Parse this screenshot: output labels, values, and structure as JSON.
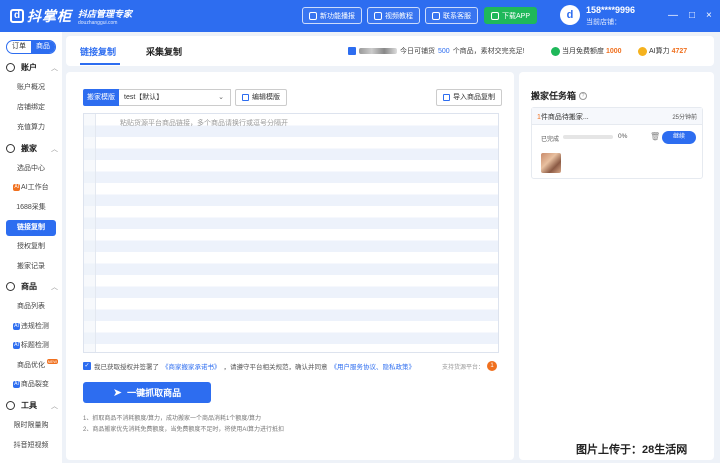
{
  "app": {
    "logo_mark": "d",
    "name": "抖掌柜",
    "tagline": "抖店管理专家",
    "domain": "douzhanggui.com"
  },
  "topbar": {
    "buttons": [
      {
        "label": "新功能播报",
        "icon": "broadcast-icon"
      },
      {
        "label": "视频教程",
        "icon": "video-icon"
      },
      {
        "label": "联系客服",
        "icon": "headset-icon"
      },
      {
        "label": "下载APP",
        "icon": "download-icon"
      }
    ],
    "user": {
      "avatar_letter": "d",
      "phone": "158****9996",
      "store_label": "当前店铺："
    },
    "window_controls": [
      "—",
      "□",
      "×"
    ]
  },
  "sidebar": {
    "segment": [
      {
        "label": "订单"
      },
      {
        "label": "商品"
      }
    ],
    "sections": [
      {
        "title": "账户",
        "items": [
          "账户概况",
          "店铺绑定",
          "充值算力"
        ]
      },
      {
        "title": "搬家",
        "items": [
          "选品中心",
          "AI工作台",
          "1688采集",
          "链接复制",
          "授权复制",
          "搬家记录"
        ]
      },
      {
        "title": "商品",
        "items": [
          "商品列表",
          "违规检测",
          "标题检测",
          "商品优化",
          "商品裂变"
        ]
      },
      {
        "title": "工具",
        "items": [
          "限时限量购",
          "抖音短视频"
        ]
      }
    ],
    "ai_badge": "AI",
    "new_badge": "NEW"
  },
  "header": {
    "tabs": [
      "链接复制",
      "采集复制"
    ],
    "notice": {
      "prefix": "今日可铺货",
      "count": "500",
      "suffix": "个商品，素材交完充足!"
    },
    "free_quota": {
      "label": "当月免费额度",
      "value": "1000"
    },
    "ai_power": {
      "label": "AI算力",
      "value": "4727"
    }
  },
  "copy_panel": {
    "template_label": "搬家模版",
    "template_value": "test【默认】",
    "edit_template": "编辑模版",
    "import_products": "导入商品复制",
    "textarea_placeholder": "粘贴货源平台商品链接，多个商品请换行或逗号分隔开",
    "agreement": {
      "text1": "我已获取授权并签署了",
      "link1": "《商家搬家承诺书》",
      "text2": "，请遵守平台相关规范，确认并同意",
      "link2": "《用户服务协议、隐私政策》"
    },
    "supported_label": "支持货源平台：",
    "grab_button": "一键抓取商品",
    "notes": [
      "1、抓取商品不消耗额度/算力，成功搬家一个商品消耗1个额度/算力",
      "2、商品搬家优先消耗免费额度，当免费额度不足时，将使用AI算力进行抵扣"
    ]
  },
  "task_box": {
    "title": "搬家任务箱",
    "task": {
      "count": "1",
      "title_suffix": "件商品待搬家...",
      "time": "25分钟前",
      "status": "已完成",
      "progress": 0,
      "progress_text": "0%",
      "action": "继续"
    }
  },
  "watermark": "图片上传于：28生活网",
  "colors": {
    "primary": "#2d6df0",
    "accent": "#f0701e",
    "success": "#1fb85a"
  }
}
